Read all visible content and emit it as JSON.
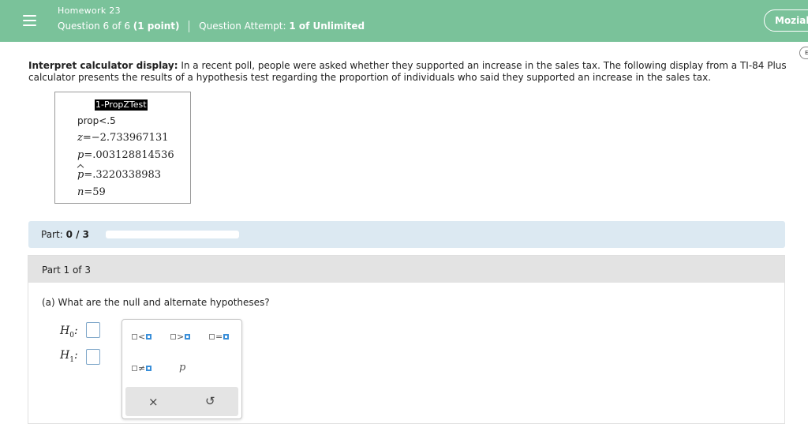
{
  "header": {
    "homework_title": "Homework 23",
    "question_position": "Question 6 of 6",
    "question_points": "(1 point)",
    "attempt_label": "Question Attempt:",
    "attempt_value": "1 of Unlimited",
    "user_name": "Moziah",
    "side_icon_text": "E",
    "menu_icon": "hamburger-menu-icon"
  },
  "prompt": {
    "bold": "Interpret calculator display:",
    "text": " In a recent poll, people were asked whether they supported an increase in the sales tax. The following display from a TI-84 Plus calculator presents the results of a hypothesis test regarding the proportion of individuals who said they supported an increase in the sales tax."
  },
  "calculator": {
    "heading": "1-PropZTest",
    "line1": "prop<.5",
    "z_label": "z",
    "z_value": "=−2.733967131",
    "p_label": "p",
    "p_value": "=.003128814536",
    "phat_label": "p",
    "phat_value": "=.3220338983",
    "n_label": "n",
    "n_value": "=59"
  },
  "progress": {
    "label": "Part:",
    "value": "0 / 3",
    "fraction": 0
  },
  "part": {
    "title": "Part 1 of 3",
    "question": "(a) What are the null and alternate hypotheses?",
    "h0_label": "H",
    "h0_sub": "0",
    "h1_label": "H",
    "h1_sub": "1",
    "colon": ":"
  },
  "palette": {
    "less_than": "<",
    "greater_than": ">",
    "equals": "=",
    "not_equal": "≠",
    "p_symbol": "p",
    "clear_symbol": "×",
    "undo_symbol": "↺"
  },
  "colors": {
    "header_green": "#7ac29a",
    "part_bar_blue": "#dce9f2",
    "input_border": "#7fa7c9",
    "palette_accent": "#3a8fd9"
  }
}
